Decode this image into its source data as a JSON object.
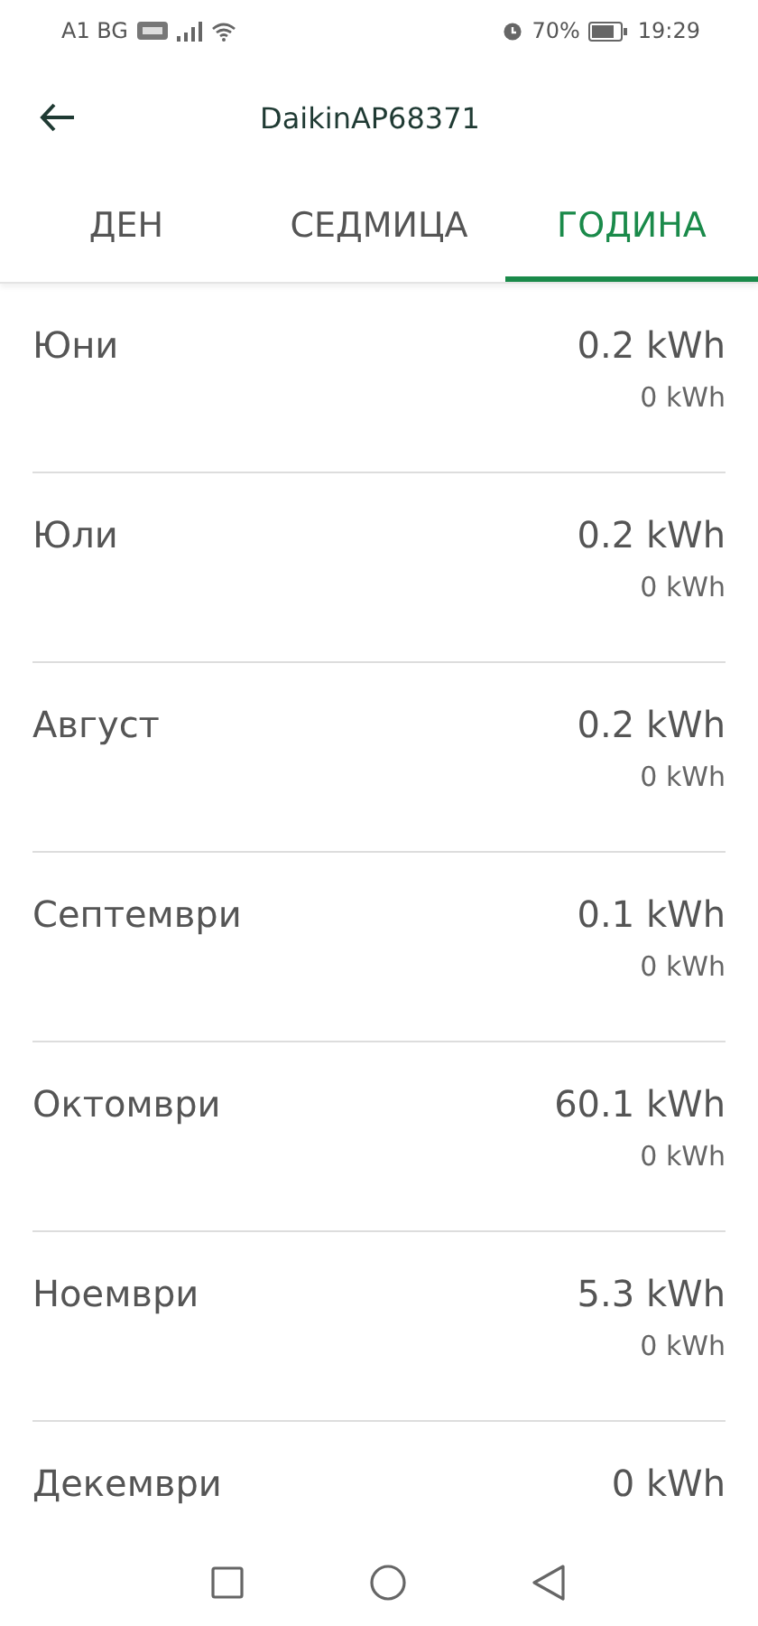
{
  "status_bar": {
    "carrier": "A1 BG",
    "battery": "70%",
    "time": "19:29"
  },
  "header": {
    "title": "DaikinAP68371"
  },
  "tabs": [
    {
      "label": "ДЕН",
      "selected": false
    },
    {
      "label": "СЕДМИЦА",
      "selected": false
    },
    {
      "label": "ГОДИНА",
      "selected": true
    }
  ],
  "months": [
    {
      "name": "Юни",
      "consumption": "0.2 kWh",
      "secondary": "0 kWh"
    },
    {
      "name": "Юли",
      "consumption": "0.2 kWh",
      "secondary": "0 kWh"
    },
    {
      "name": "Август",
      "consumption": "0.2 kWh",
      "secondary": "0 kWh"
    },
    {
      "name": "Септември",
      "consumption": "0.1 kWh",
      "secondary": "0 kWh"
    },
    {
      "name": "Октомври",
      "consumption": "60.1 kWh",
      "secondary": "0 kWh"
    },
    {
      "name": "Ноември",
      "consumption": "5.3 kWh",
      "secondary": "0 kWh"
    },
    {
      "name": "Декември",
      "consumption": "0 kWh"
    }
  ]
}
